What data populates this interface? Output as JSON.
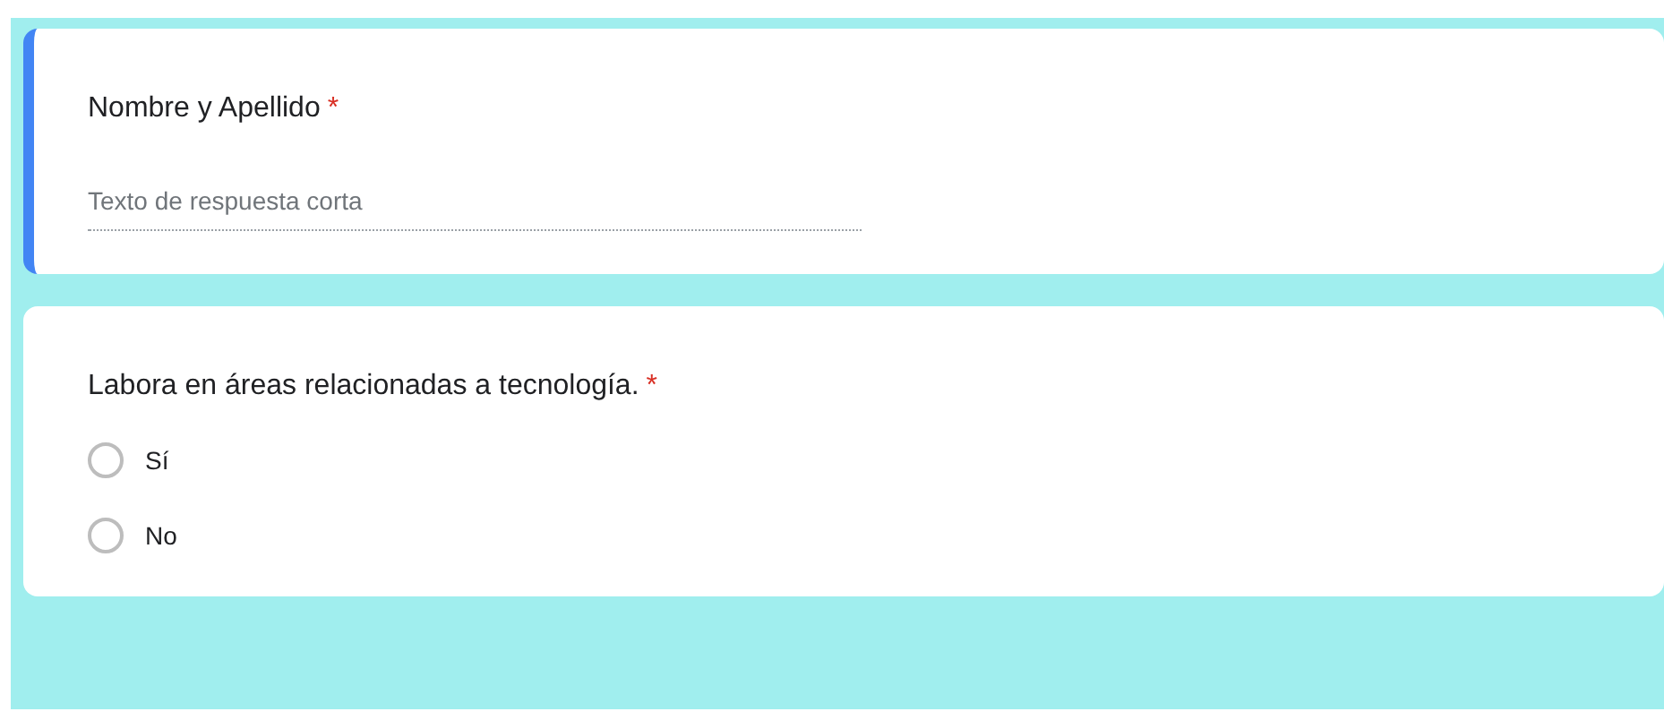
{
  "questions": [
    {
      "kind": "short_answer",
      "title": "Nombre y Apellido",
      "required_mark": "*",
      "focused": true,
      "placeholder": "Texto de respuesta corta"
    },
    {
      "kind": "choice",
      "title": "Labora en áreas relacionadas a tecnología.",
      "required_mark": "*",
      "focused": false,
      "options": [
        {
          "label": "Sí",
          "selected": false
        },
        {
          "label": "No",
          "selected": false
        }
      ]
    }
  ]
}
